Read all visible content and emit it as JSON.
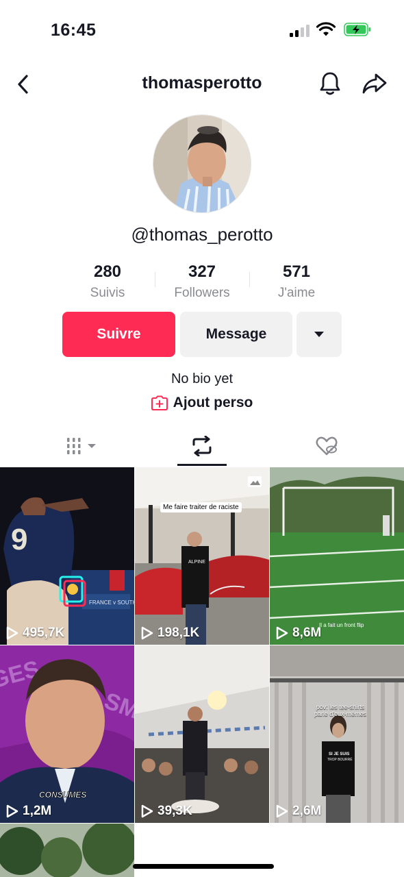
{
  "status_bar": {
    "time": "16:45"
  },
  "header": {
    "title": "thomasperotto"
  },
  "profile": {
    "handle": "@thomas_perotto",
    "stats": [
      {
        "value": "280",
        "label": "Suivis"
      },
      {
        "value": "327",
        "label": "Followers"
      },
      {
        "value": "571",
        "label": "J'aime"
      }
    ],
    "buttons": {
      "follow": "Suivre",
      "message": "Message"
    },
    "bio": "No bio yet",
    "add_link": "Ajout perso"
  },
  "tabs": [
    {
      "icon": "grid-icon",
      "active": false
    },
    {
      "icon": "repost-icon",
      "active": true
    },
    {
      "icon": "liked-hidden-icon",
      "active": false
    }
  ],
  "videos": [
    {
      "views": "495,7K",
      "caption": ""
    },
    {
      "views": "198,1K",
      "caption": "Me faire traiter de raciste"
    },
    {
      "views": "8,6M",
      "caption": "Il a fait un front flip"
    },
    {
      "views": "1,2M",
      "caption": "CONSUMÉS"
    },
    {
      "views": "39,3K",
      "caption": ""
    },
    {
      "views": "2,6M",
      "caption": "pov: les tee-shirts parle d'eux-mêmes"
    }
  ],
  "colors": {
    "accent": "#fe2c55",
    "text": "#161823",
    "muted": "#8a8b91",
    "button_bg": "#f1f1f2"
  }
}
